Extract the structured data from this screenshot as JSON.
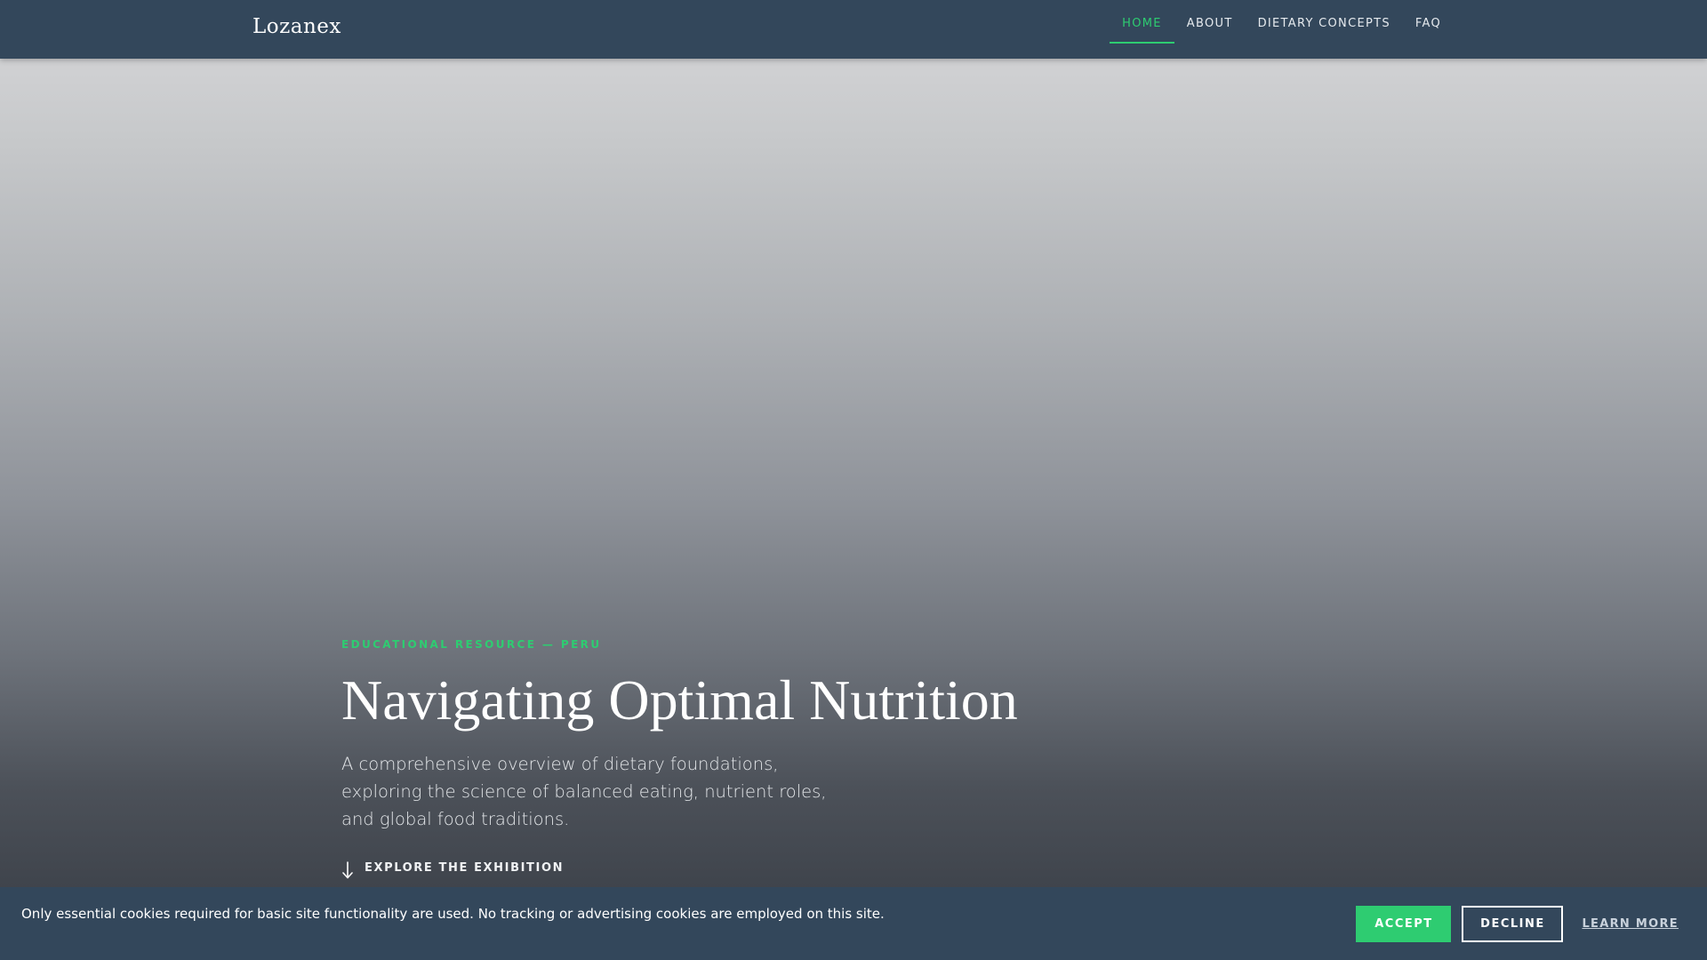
{
  "header": {
    "brand": "Lozanex",
    "nav": [
      {
        "label": "HOME",
        "active": true
      },
      {
        "label": "ABOUT",
        "active": false
      },
      {
        "label": "DIETARY CONCEPTS",
        "active": false
      },
      {
        "label": "FAQ",
        "active": false
      }
    ]
  },
  "hero": {
    "eyebrow": "EDUCATIONAL RESOURCE — PERU",
    "title": "Navigating Optimal Nutrition",
    "subtitle": "A comprehensive overview of dietary foundations, exploring the science of balanced eating, nutrient roles, and global food traditions.",
    "cta": {
      "label": "EXPLORE THE EXHIBITION",
      "icon": "arrow-down-icon"
    }
  },
  "cookie_banner": {
    "message": "Only essential cookies required for basic site functionality are used. No tracking or advertising cookies are employed on this site.",
    "accept_label": "ACCEPT",
    "decline_label": "DECLINE",
    "learn_more_label": "LEARN MORE"
  },
  "colors": {
    "nav_background": "#33475b",
    "accent": "#2ecc71",
    "text_light": "#ffffff"
  }
}
